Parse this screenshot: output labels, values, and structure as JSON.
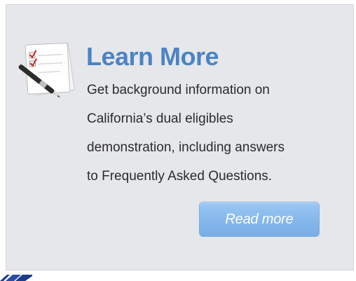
{
  "card": {
    "title": "Learn More",
    "description": "Get background information on\nCalifornia’s dual eligibles\ndemonstration, including answers\nto Frequently Asked Questions.",
    "read_more_label": "Read more",
    "icon": "notepad-checklist-with-pen-icon"
  },
  "colors": {
    "title": "#4c83c4",
    "card_background": "#e5e7ea",
    "button_background": "#86b8ec",
    "text": "#2b2b2b"
  }
}
